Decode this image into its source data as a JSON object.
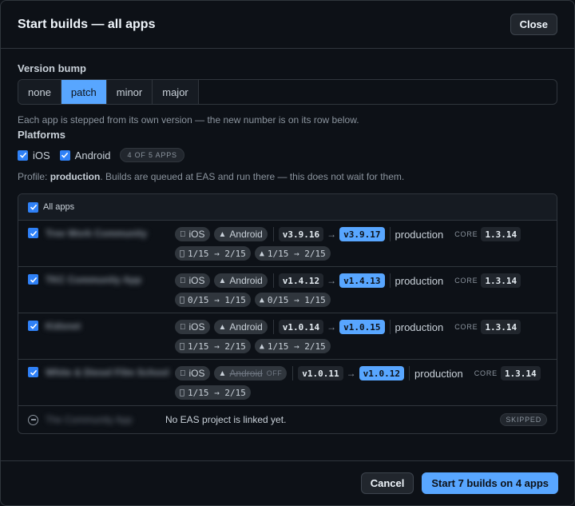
{
  "header": {
    "title": "Start builds — all apps",
    "close_label": "Close"
  },
  "version_bump": {
    "label": "Version bump",
    "options": [
      "none",
      "patch",
      "minor",
      "major"
    ],
    "selected": "patch",
    "hint": "Each app is stepped from its own version — the new number is on its row below."
  },
  "platforms": {
    "label": "Platforms",
    "ios_label": "iOS",
    "android_label": "Android",
    "count_badge": "4 OF 5 APPS"
  },
  "profile": {
    "prefix": "Profile: ",
    "name": "production",
    "suffix": ". Builds are queued at EAS and run there — this does not wait for them."
  },
  "apps_table": {
    "all_label": "All apps",
    "ios_pill": "iOS",
    "android_pill": "Android",
    "off_tag": "OFF",
    "core_label": "CORE",
    "arrow": "→",
    "rows": [
      {
        "name": "Tree Work Community",
        "current": "v3.9.16",
        "next": "v3.9.17",
        "profile": "production",
        "core": "1.3.14",
        "ios_progress": "1/15 → 2/15",
        "android_progress": "1/15 → 2/15",
        "android_off": false
      },
      {
        "name": "TKC Community App",
        "current": "v1.4.12",
        "next": "v1.4.13",
        "profile": "production",
        "core": "1.3.14",
        "ios_progress": "0/15 → 1/15",
        "android_progress": "0/15 → 1/15",
        "android_off": false
      },
      {
        "name": "Kidsnet",
        "current": "v1.0.14",
        "next": "v1.0.15",
        "profile": "production",
        "core": "1.3.14",
        "ios_progress": "1/15 → 2/15",
        "android_progress": "1/15 → 2/15",
        "android_off": false
      },
      {
        "name": "White & Diesel Film School",
        "current": "v1.0.11",
        "next": "v1.0.12",
        "profile": "production",
        "core": "1.3.14",
        "ios_progress": "1/15 → 2/15",
        "android_progress": "",
        "android_off": true
      }
    ],
    "skipped": {
      "name": "The Community App",
      "message": "No EAS project is linked yet.",
      "badge": "SKIPPED"
    }
  },
  "footer": {
    "cancel_label": "Cancel",
    "start_label": "Start 7 builds on 4 apps"
  },
  "colors": {
    "accent": "#58a6ff",
    "background": "#0d1117",
    "border": "#30363d"
  },
  "icons": {
    "ios": "apple-icon",
    "android": "android-icon",
    "checkbox": "check-icon",
    "skipped": "minus-circle-icon"
  }
}
